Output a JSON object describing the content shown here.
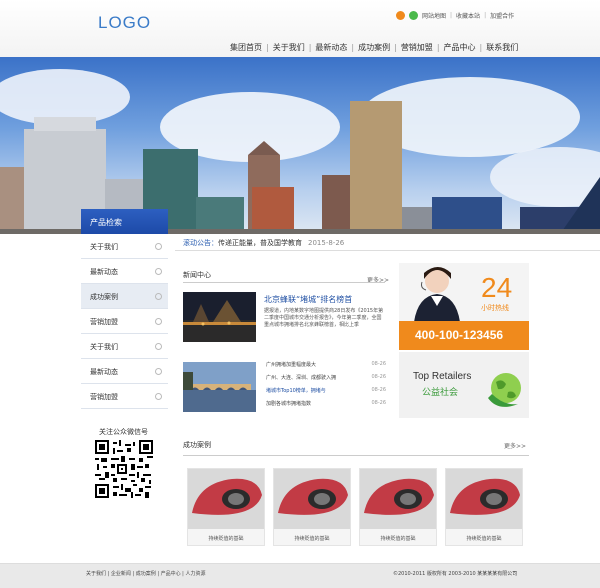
{
  "logo": "LOGO",
  "top_links": [
    "网站地图",
    "收藏本站",
    "加盟合作"
  ],
  "nav": [
    "集团首页",
    "关于我们",
    "最新动态",
    "成功案例",
    "营销加盟",
    "产品中心",
    "联系我们"
  ],
  "sidebar": {
    "header": "产品检索",
    "items": [
      "关于我们",
      "最新动态",
      "成功案例",
      "营销加盟",
      "关于我们",
      "最新动态",
      "营销加盟"
    ],
    "active_index": 2,
    "qr_title": "关注公众微信号"
  },
  "notice": {
    "label": "滚动公告：",
    "text": "传递正能量，普及国学教育",
    "date": "2015-8-26"
  },
  "news": {
    "title": "新闻中心",
    "more": "更多>>",
    "headline": "北京蜂联“堵城”排名榜首",
    "body": "据报道，内地某数字地图提供商28日发布《2015年第二季度中国城市交通分析报告》，今年第二季度，全国重点城市拥堵排名北京蜂联榜首，相比上季",
    "list": [
      {
        "text": "广州拥堵加重幅度最大",
        "date": "08-26"
      },
      {
        "text": "广州、大连、深圳、成都驶入拥",
        "date": "08-26"
      },
      {
        "text": "堵城市Top10榜单，拥堵与",
        "date": "08-26"
      },
      {
        "text": "加剧各城市拥堵指数",
        "date": "08-26"
      }
    ]
  },
  "hotline": {
    "big": "24",
    "sub": "小时热线",
    "phone": "400-100-123456"
  },
  "retail": {
    "en": "Top Retailers",
    "cn": "公益社会"
  },
  "cases": {
    "title": "成功案例",
    "more": "更多>>",
    "items": [
      "持续贬值的基础",
      "持续贬值的基础",
      "持续贬值的基础",
      "持续贬值的基础"
    ]
  },
  "footer": {
    "links": "关于我们 | 企业新闻 | 成功案例 | 产品中心 | 人力资源",
    "copyright": "©2010-2011 版权所有 2003-2010 某某某某有限公司"
  },
  "colors": {
    "accent": "#1f4fa3",
    "orange": "#f08a1c",
    "green": "#3a9a3a"
  }
}
